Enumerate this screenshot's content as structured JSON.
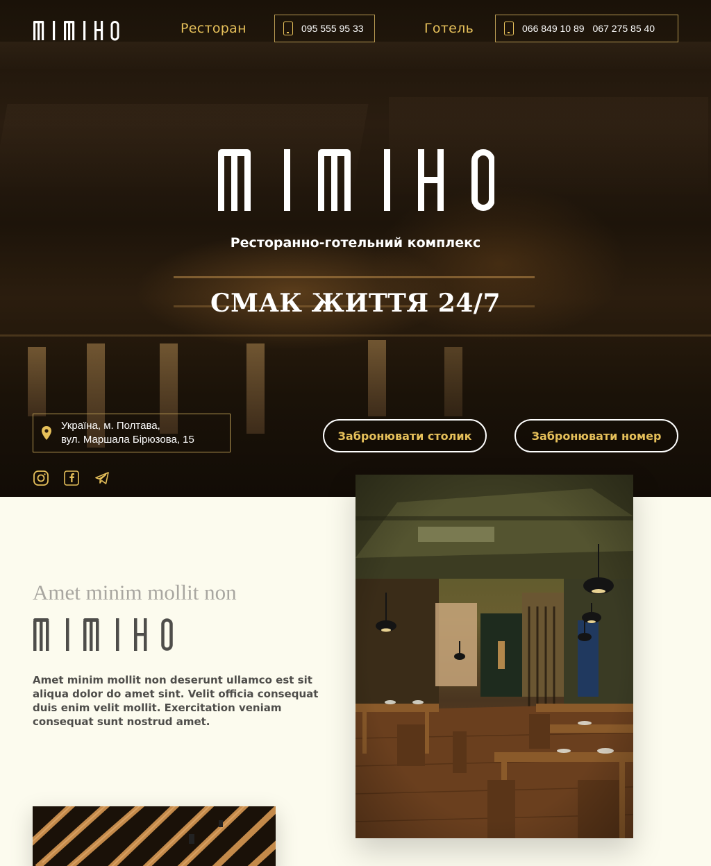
{
  "header": {
    "brand": "MIMIHO",
    "restaurant_label": "Ресторан",
    "restaurant_phone": "095 555 95 33",
    "hotel_label": "Готель",
    "hotel_phones": [
      "066 849 10 89",
      "067 275 85 40"
    ]
  },
  "hero": {
    "brand": "MIMIHO",
    "subtitle": "Ресторанно-готельний комплекс",
    "slogan": "СМАК ЖИТТЯ 24/7",
    "address_line1": "Україна, м. Полтава,",
    "address_line2": "вул. Маршала Бірюзова, 15",
    "book_table_label": "Забронювати столик",
    "book_room_label": "Забронювати номер",
    "social": [
      "instagram-icon",
      "facebook-icon",
      "telegram-icon"
    ]
  },
  "about": {
    "kicker": "Amet minim mollit non",
    "brand": "MIMIHO",
    "text": "Amet minim mollit non deserunt ullamco est sit aliqua dolor do amet sint. Velit officia consequat duis enim velit mollit. Exercitation veniam consequat sunt nostrud amet."
  },
  "colors": {
    "accent": "#e6c05a",
    "border": "#b89a52",
    "page_bg": "#fcfbee",
    "text_dark": "#4e4d4a",
    "kicker": "#a8a6a0"
  }
}
